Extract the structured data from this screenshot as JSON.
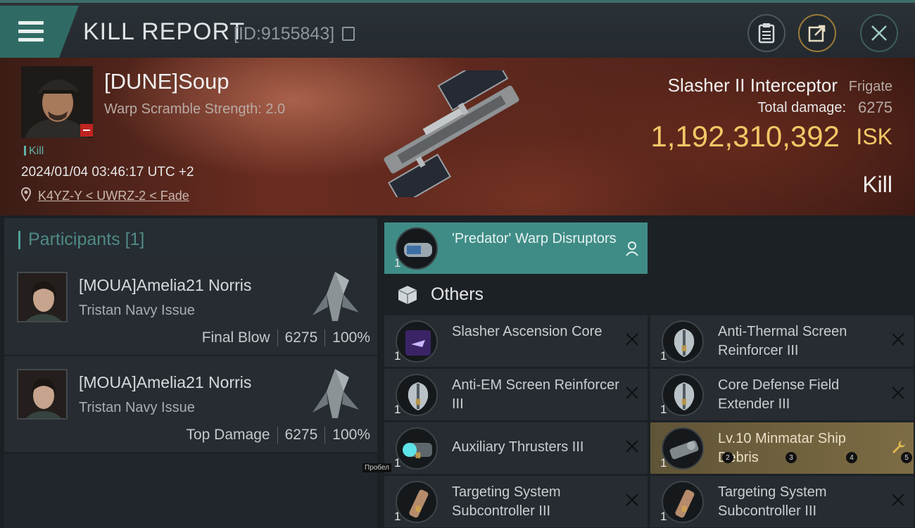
{
  "header": {
    "title": "KILL REPORT",
    "report_id": "[ID:9155843]"
  },
  "victim": {
    "name": "[DUNE]Soup",
    "scramble_strength": "Warp Scramble Strength: 2.0",
    "tag": "Kill",
    "datetime": "2024/01/04 03:46:17 UTC +2",
    "location": "K4YZ-Y < UWRZ-2 < Fade",
    "ship_name": "Slasher II Interceptor",
    "ship_class": "Frigate",
    "total_damage_label": "Total damage:",
    "total_damage": "6275",
    "isk_value": "1,192,310,392",
    "isk_unit": "ISK",
    "result": "Kill"
  },
  "participants": {
    "header": "Participants",
    "count": "[1]",
    "rows": [
      {
        "name": "[MOUA]Amelia21 Norris",
        "ship": "Tristan Navy Issue",
        "role": "Final Blow",
        "damage": "6275",
        "percent": "100%"
      },
      {
        "name": "[MOUA]Amelia21 Norris",
        "ship": "Tristan Navy Issue",
        "role": "Top Damage",
        "damage": "6275",
        "percent": "100%"
      }
    ]
  },
  "modules": {
    "fitted": {
      "name": "'Predator' Warp Disruptors",
      "qty": "1"
    },
    "others_header": "Others",
    "items": [
      {
        "name": "Slasher Ascension Core",
        "qty": "1"
      },
      {
        "name": "Anti-Thermal Screen Reinforcer III",
        "qty": "1"
      },
      {
        "name": "Anti-EM Screen Reinforcer III",
        "qty": "1"
      },
      {
        "name": "Core Defense Field Extender III",
        "qty": "1"
      },
      {
        "name": "Auxiliary Thrusters III",
        "qty": "1"
      },
      {
        "name": "Lv.10 Minmatar Ship Debris",
        "qty": "1"
      },
      {
        "name": "Targeting System Subcontroller III",
        "qty": "1"
      },
      {
        "name": "Targeting System Subcontroller III",
        "qty": "1"
      }
    ]
  },
  "overlay": {
    "key_hint": "Пробел",
    "badges": [
      "2",
      "3",
      "4",
      "5"
    ]
  },
  "colors": {
    "accent_teal": "#3f8c86",
    "isk_gold": "#f2c766",
    "loss_red": "#c0241f"
  }
}
